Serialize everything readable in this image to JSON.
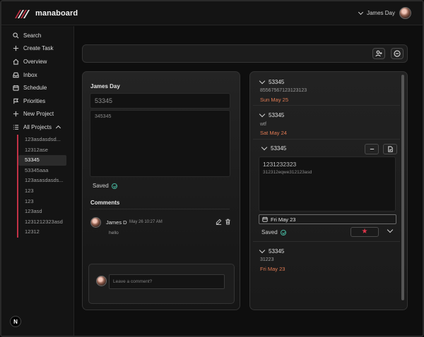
{
  "app": {
    "name": "manaboard",
    "brand_color": "#c23246"
  },
  "user": {
    "name": "James Day"
  },
  "sidebar": {
    "items": [
      {
        "label": "Search",
        "icon": "search-icon"
      },
      {
        "label": "Create Task",
        "icon": "plus-icon"
      },
      {
        "label": "Overview",
        "icon": "home-icon"
      },
      {
        "label": "Inbox",
        "icon": "inbox-icon"
      },
      {
        "label": "Schedule",
        "icon": "calendar-icon"
      },
      {
        "label": "Priorities",
        "icon": "flag-icon"
      },
      {
        "label": "New Project",
        "icon": "plus-icon"
      },
      {
        "label": "All Projects",
        "icon": "list-icon"
      }
    ],
    "projects": [
      "123asdasdsd...",
      "12312ase",
      "53345",
      "53345aaa",
      "123asasdasds...",
      "123",
      "123",
      "123asd",
      "1231212323asd",
      "12312"
    ],
    "active_project": "53345"
  },
  "editor": {
    "owner": "James Day",
    "title_value": "53345",
    "description_value": "345345",
    "status": "Saved",
    "comments_heading": "Comments",
    "comment": {
      "author": "James D",
      "date": "May 26 10:27 AM",
      "text": "hello"
    },
    "comment_placeholder": "Leave a comment?"
  },
  "tasks": [
    {
      "title": "53345",
      "description": "85567567123123123",
      "date": "Sun May 25"
    },
    {
      "title": "53345",
      "description": "wtf",
      "date": "Sat May 24"
    },
    {
      "title": "53345",
      "title_value": "1231232323",
      "description": "312312eqwe312123asd",
      "date": "Fri May 23",
      "status": "Saved"
    },
    {
      "title": "53345",
      "description": "31223",
      "date": "Fri May 23"
    }
  ],
  "branding": {
    "badge": "N"
  },
  "colors": {
    "date_accent": "#e07a53",
    "saved_check": "#46b39c",
    "star": "#e0364b"
  }
}
